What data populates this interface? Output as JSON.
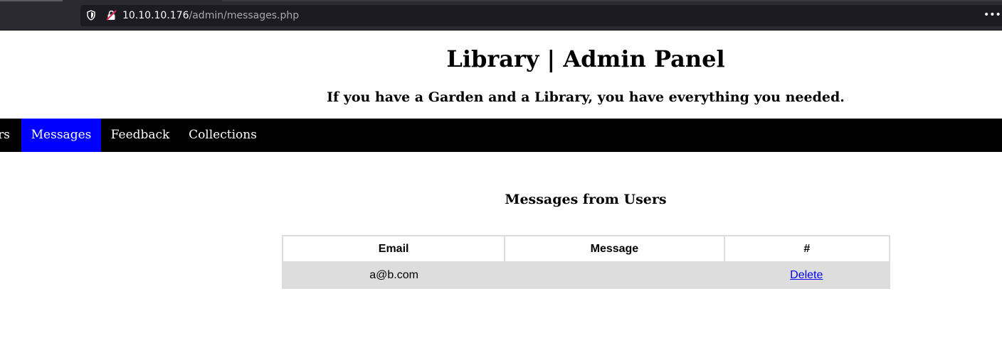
{
  "browser": {
    "url_host": "10.10.10.176",
    "url_path": "/admin/messages.php",
    "shield_icon": "shield-icon",
    "lock_icon": "insecure-lock-icon",
    "menu_icon": "ellipsis-icon",
    "menu_glyph": "•••"
  },
  "header": {
    "title": "Library | Admin Panel",
    "tagline": "If you have a Garden and a Library, you have everything you needed."
  },
  "nav": {
    "partial_label": "rs",
    "items": [
      {
        "label": "Messages",
        "active": true
      },
      {
        "label": "Feedback",
        "active": false
      },
      {
        "label": "Collections",
        "active": false
      }
    ],
    "background": "#000000",
    "active_color": "#0000ff"
  },
  "main": {
    "heading": "Messages from Users",
    "table": {
      "columns": [
        "Email",
        "Message",
        "#"
      ],
      "rows": [
        {
          "email": "a@b.com",
          "message": "",
          "action": "Delete"
        }
      ]
    }
  }
}
